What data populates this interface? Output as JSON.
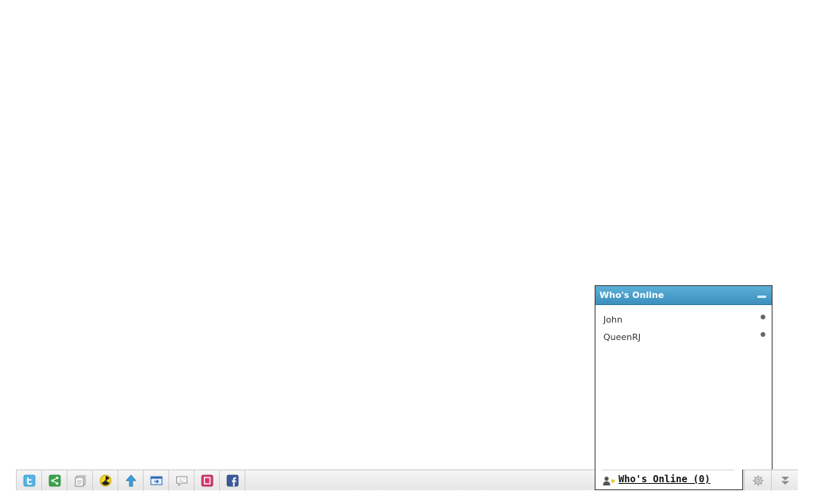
{
  "toolbar": {
    "buttons": [
      {
        "icon": "twitter-icon"
      },
      {
        "icon": "share-icon"
      },
      {
        "icon": "pages-icon"
      },
      {
        "icon": "radioactive-icon"
      },
      {
        "icon": "arrow-up-icon"
      },
      {
        "icon": "export-icon"
      },
      {
        "icon": "comment-icon"
      },
      {
        "icon": "frame-icon"
      },
      {
        "icon": "facebook-icon"
      }
    ],
    "settings_icon": "gear-icon",
    "collapse_icon": "double-chevron-down-icon"
  },
  "whos_online_panel": {
    "title": "Who's Online",
    "users": [
      {
        "name": "John",
        "status": "offline"
      },
      {
        "name": "QueenRJ",
        "status": "offline"
      }
    ]
  },
  "whos_online_tab": {
    "label": "Who's Online (0)"
  },
  "colors": {
    "header_top": "#5bb0d8",
    "header_bottom": "#3c8fbd",
    "status_dot": "#666666"
  }
}
